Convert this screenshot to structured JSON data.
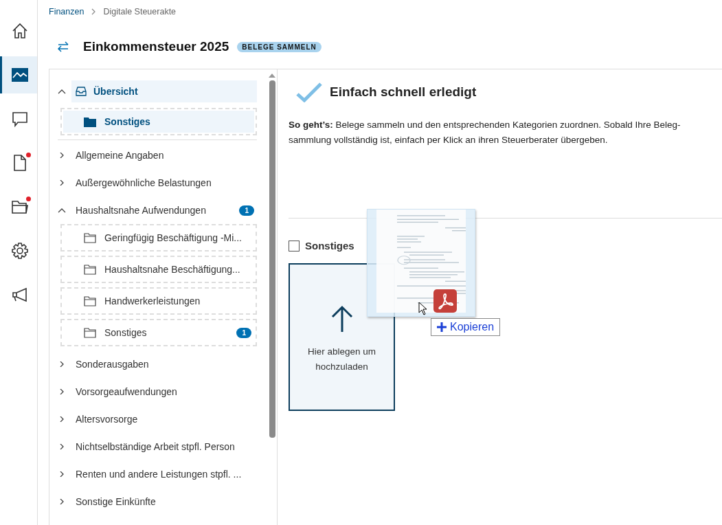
{
  "nav_rail": [
    {
      "kind": "home",
      "selected": false,
      "notification": false
    },
    {
      "kind": "chart",
      "selected": true,
      "notification": false
    },
    {
      "kind": "chat",
      "selected": false,
      "notification": false
    },
    {
      "kind": "document",
      "selected": false,
      "notification": true
    },
    {
      "kind": "folder",
      "selected": false,
      "notification": true
    },
    {
      "kind": "settings",
      "selected": false,
      "notification": false
    },
    {
      "kind": "megaphone",
      "selected": false,
      "notification": false
    }
  ],
  "breadcrumb": [
    {
      "label": "Finanzen",
      "link": true
    },
    {
      "label": "Digitale Steuerakte",
      "link": false
    }
  ],
  "title": "Einkommensteuer 2025",
  "status_badge": "BELEGE SAMMELN",
  "tree": [
    {
      "label": "Übersicht",
      "kind": "overview",
      "expanded": true,
      "selected": true,
      "children": [
        {
          "label": "Sonstiges",
          "selected": true
        }
      ]
    },
    {
      "label": "Allgemeine Angaben",
      "kind": "group",
      "expanded": false,
      "selected": false
    },
    {
      "label": "Außergewöhnliche Belastungen",
      "kind": "group",
      "expanded": false,
      "selected": false
    },
    {
      "label": "Haushaltsnahe Aufwendungen",
      "kind": "group",
      "expanded": true,
      "selected": false,
      "badge": "1",
      "children": [
        {
          "label": "Geringfügig Beschäftigung -Mi...",
          "selected": false
        },
        {
          "label": "Haushaltsnahe Beschäftigung...",
          "selected": false
        },
        {
          "label": "Handwerkerleistungen",
          "selected": false
        },
        {
          "label": "Sonstiges",
          "selected": false,
          "badge": "1"
        }
      ]
    },
    {
      "label": "Sonderausgaben",
      "kind": "group",
      "expanded": false,
      "selected": false
    },
    {
      "label": "Vorsorgeaufwendungen",
      "kind": "group",
      "expanded": false,
      "selected": false
    },
    {
      "label": "Altersvorsorge",
      "kind": "group",
      "expanded": false,
      "selected": false
    },
    {
      "label": "Nichtselbständige Arbeit stpfl. Person",
      "kind": "group",
      "expanded": false,
      "selected": false
    },
    {
      "label": "Renten und andere Leistungen stpfl. ...",
      "kind": "group",
      "expanded": false,
      "selected": false
    },
    {
      "label": "Sonstige Einkünfte",
      "kind": "group",
      "expanded": false,
      "selected": false
    }
  ],
  "info": {
    "heading": "Einfach schnell erledigt",
    "lines": [
      "**So geht’s:** Belege sammeln und den entsprechenden Kategorien zuordnen. Sobald Ihre Beleg-",
      "sammlung vollständig ist, einfach per Klick an ihren Steuerberater übergeben."
    ]
  },
  "category": {
    "label": "Sonstiges",
    "checked": false
  },
  "dropzone": {
    "label": "Hier ablegen um hochzuladen"
  },
  "drag": {
    "tooltip": "Kopieren"
  }
}
